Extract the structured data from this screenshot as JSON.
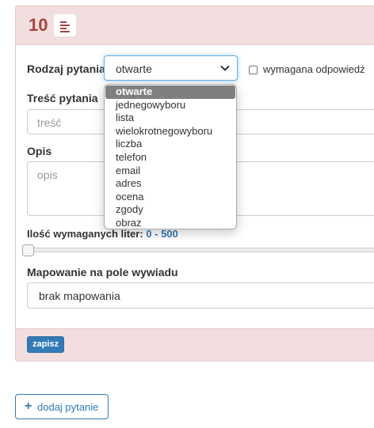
{
  "question": {
    "number": "10",
    "type_icon": "text-align-left-icon"
  },
  "form": {
    "type_label": "Rodzaj pytania",
    "type_selected": "otwarte",
    "type_options": [
      "otwarte",
      "jednegowyboru",
      "lista",
      "wielokrotnegowyboru",
      "liczba",
      "telefon",
      "email",
      "adres",
      "ocena",
      "zgody",
      "obraz"
    ],
    "required_label": "wymagana odpowiedź",
    "content_label": "Treść pytania",
    "content_placeholder": "treść",
    "description_label": "Opis",
    "description_placeholder": "opis",
    "length_label": "Ilość wymaganych liter:",
    "length_value": "0 - 500",
    "length_range": {
      "min": 0,
      "max": 500
    },
    "mapping_label": "Mapowanie na pole wywiadu",
    "mapping_value": "brak mapowania"
  },
  "footer": {
    "save_label": "zapisz"
  },
  "add_question_label": "dodaj pytanie",
  "colors": {
    "danger_bg": "#f2dede",
    "danger_text": "#a94442",
    "primary": "#337ab7"
  }
}
